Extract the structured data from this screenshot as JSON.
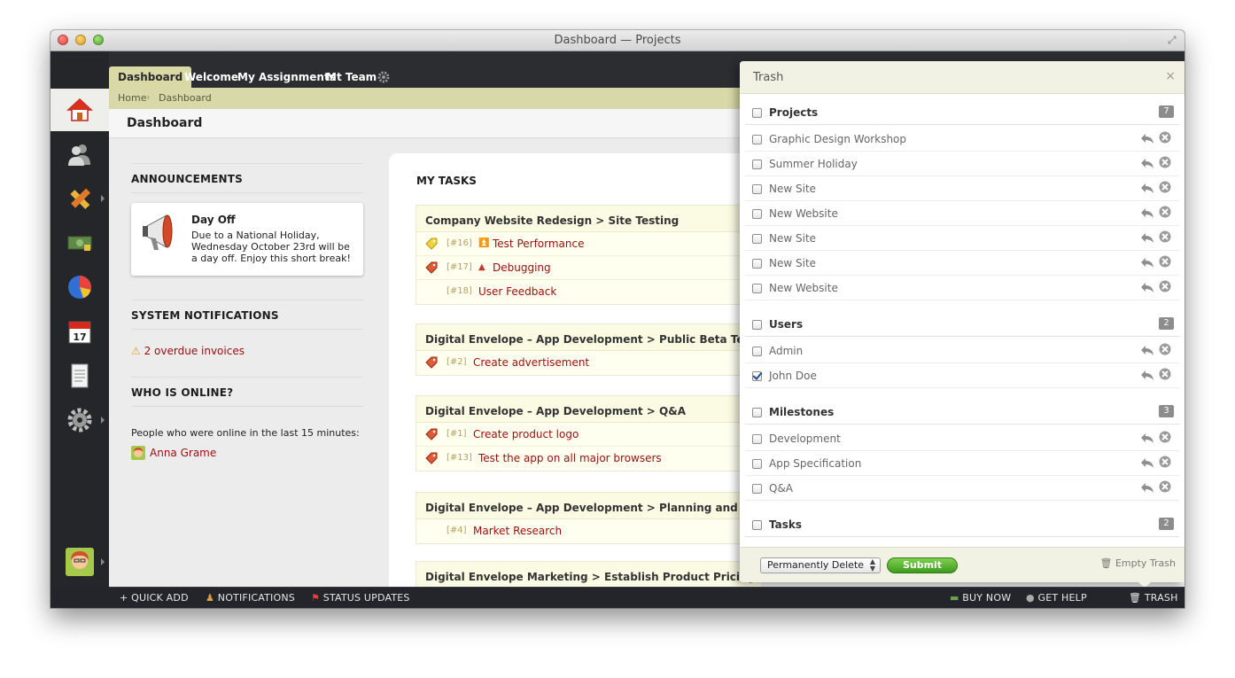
{
  "window": {
    "title": "Dashboard — Projects"
  },
  "nav": {
    "tabs": [
      "Dashboard",
      "Welcome",
      "My Assignments",
      "Mt Team"
    ],
    "breadcrumb": [
      "Home",
      "Dashboard"
    ],
    "page_title": "Dashboard"
  },
  "announcements": {
    "heading": "ANNOUNCEMENTS",
    "title": "Day Off",
    "body": "Due to a National Holiday, Wednesday October 23rd will be a day off. Enjoy this short break!"
  },
  "system_notifications": {
    "heading": "SYSTEM NOTIFICATIONS",
    "item": "2 overdue invoices"
  },
  "who_online": {
    "heading": "WHO IS ONLINE?",
    "text": "People who were online in the last 15 minutes:",
    "user": "Anna Grame"
  },
  "my_tasks": {
    "heading": "MY TASKS",
    "groups": [
      {
        "title": "Company Website Redesign > Site Testing",
        "tasks": [
          {
            "num": "[#16]",
            "title": "Test Performance",
            "tag": "yellow",
            "priority": "highest"
          },
          {
            "num": "[#17]",
            "title": "Debugging",
            "tag": "red",
            "priority": "high"
          },
          {
            "num": "[#18]",
            "title": "User Feedback",
            "tag": "",
            "priority": ""
          }
        ]
      },
      {
        "title": "Digital Envelope – App Development > Public Beta Testing",
        "tasks": [
          {
            "num": "[#2]",
            "title": "Create advertisement",
            "tag": "red",
            "priority": ""
          }
        ]
      },
      {
        "title": "Digital Envelope – App Development > Q&A",
        "tasks": [
          {
            "num": "[#1]",
            "title": "Create product logo",
            "tag": "red",
            "priority": ""
          },
          {
            "num": "[#13]",
            "title": "Test the app on all major browsers",
            "tag": "red",
            "priority": ""
          }
        ]
      },
      {
        "title": "Digital Envelope – App Development > Planning and Reseach",
        "tasks": [
          {
            "num": "[#4]",
            "title": "Market Research",
            "tag": "",
            "priority": ""
          }
        ]
      },
      {
        "title": "Digital Envelope Marketing > Establish Product Pricing",
        "tasks": []
      }
    ]
  },
  "trash": {
    "title": "Trash",
    "close": "×",
    "groups": [
      {
        "label": "Projects",
        "count": "7",
        "items": [
          {
            "label": "Graphic Design Workshop",
            "checked": false
          },
          {
            "label": "Summer Holiday",
            "checked": false
          },
          {
            "label": "New Site",
            "checked": false
          },
          {
            "label": "New Website",
            "checked": false
          },
          {
            "label": "New Site",
            "checked": false
          },
          {
            "label": "New Site",
            "checked": false
          },
          {
            "label": "New Website",
            "checked": false
          }
        ]
      },
      {
        "label": "Users",
        "count": "2",
        "items": [
          {
            "label": "Admin",
            "checked": false
          },
          {
            "label": "John Doe",
            "checked": true
          }
        ]
      },
      {
        "label": "Milestones",
        "count": "3",
        "items": [
          {
            "label": "Development",
            "checked": false
          },
          {
            "label": "App Specification",
            "checked": false
          },
          {
            "label": "Q&A",
            "checked": false
          }
        ]
      },
      {
        "label": "Tasks",
        "count": "2",
        "items": []
      }
    ],
    "action_select": "Permanently Delete",
    "submit": "Submit",
    "empty": "Empty Trash"
  },
  "bottombar": {
    "quick_add": "QUICK ADD",
    "notifications": "NOTIFICATIONS",
    "status_updates": "STATUS UPDATES",
    "buy_now": "BUY NOW",
    "get_help": "GET HELP",
    "trash": "TRASH"
  },
  "colors": {
    "accent_tab": "#d9d9a6",
    "link": "#9b0d0d",
    "submit": "#4caf2a",
    "dark": "#2c2d31"
  }
}
